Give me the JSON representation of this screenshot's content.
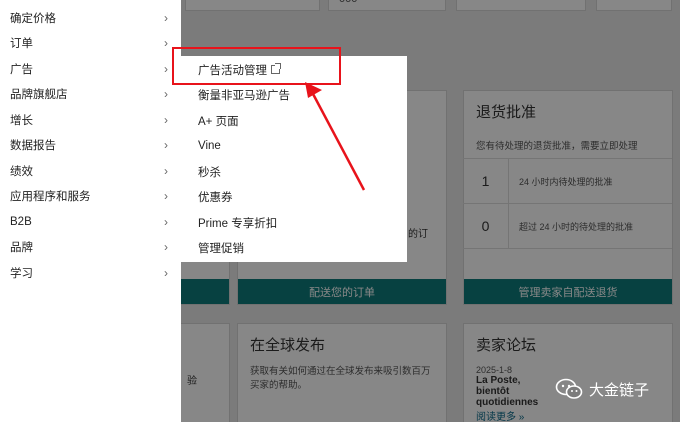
{
  "left_menu": {
    "items": [
      {
        "label": "确定价格"
      },
      {
        "label": "订单"
      },
      {
        "label": "广告"
      },
      {
        "label": "品牌旗舰店"
      },
      {
        "label": "增长"
      },
      {
        "label": "数据报告"
      },
      {
        "label": "绩效"
      },
      {
        "label": "应用程序和服务"
      },
      {
        "label": "B2B"
      },
      {
        "label": "品牌"
      },
      {
        "label": "学习"
      }
    ],
    "chevron": "›"
  },
  "submenu": {
    "items": [
      {
        "label": "广告活动管理"
      },
      {
        "label": "衡量非亚马逊广告"
      },
      {
        "label": "A+ 页面"
      },
      {
        "label": "Vine"
      },
      {
        "label": "秒杀"
      },
      {
        "label": "优惠券"
      },
      {
        "label": "Prime 专享折扣"
      },
      {
        "label": "管理促销"
      }
    ]
  },
  "background": {
    "returns_card": {
      "title": "退货批准",
      "subtitle": "您有待处理的退货批准，需要立即处理",
      "rows": [
        {
          "num": "1",
          "text": "24 小时内待处理的批准"
        },
        {
          "num": "0",
          "text": "超过 24 小时的待处理的批准"
        }
      ],
      "button": "管理卖家自配送退货"
    },
    "orders_card": {
      "snippet": "的订",
      "button": "配送您的订单"
    },
    "global_card": {
      "title": "在全球发布",
      "text": "获取有关如何通过在全球发布来吸引数百万买家的帮助。"
    },
    "forum_card": {
      "title": "卖家论坛",
      "date": "2025-1-8",
      "post": "La Poste, bientôt quotidiennes",
      "link": "阅读更多 »"
    },
    "left_partial": {
      "text": "验"
    },
    "top_numbers": [
      "000"
    ]
  },
  "watermark": {
    "text": "大金链子"
  },
  "colors": {
    "highlight": "#e8131b",
    "teal": "#0f7c7c"
  }
}
